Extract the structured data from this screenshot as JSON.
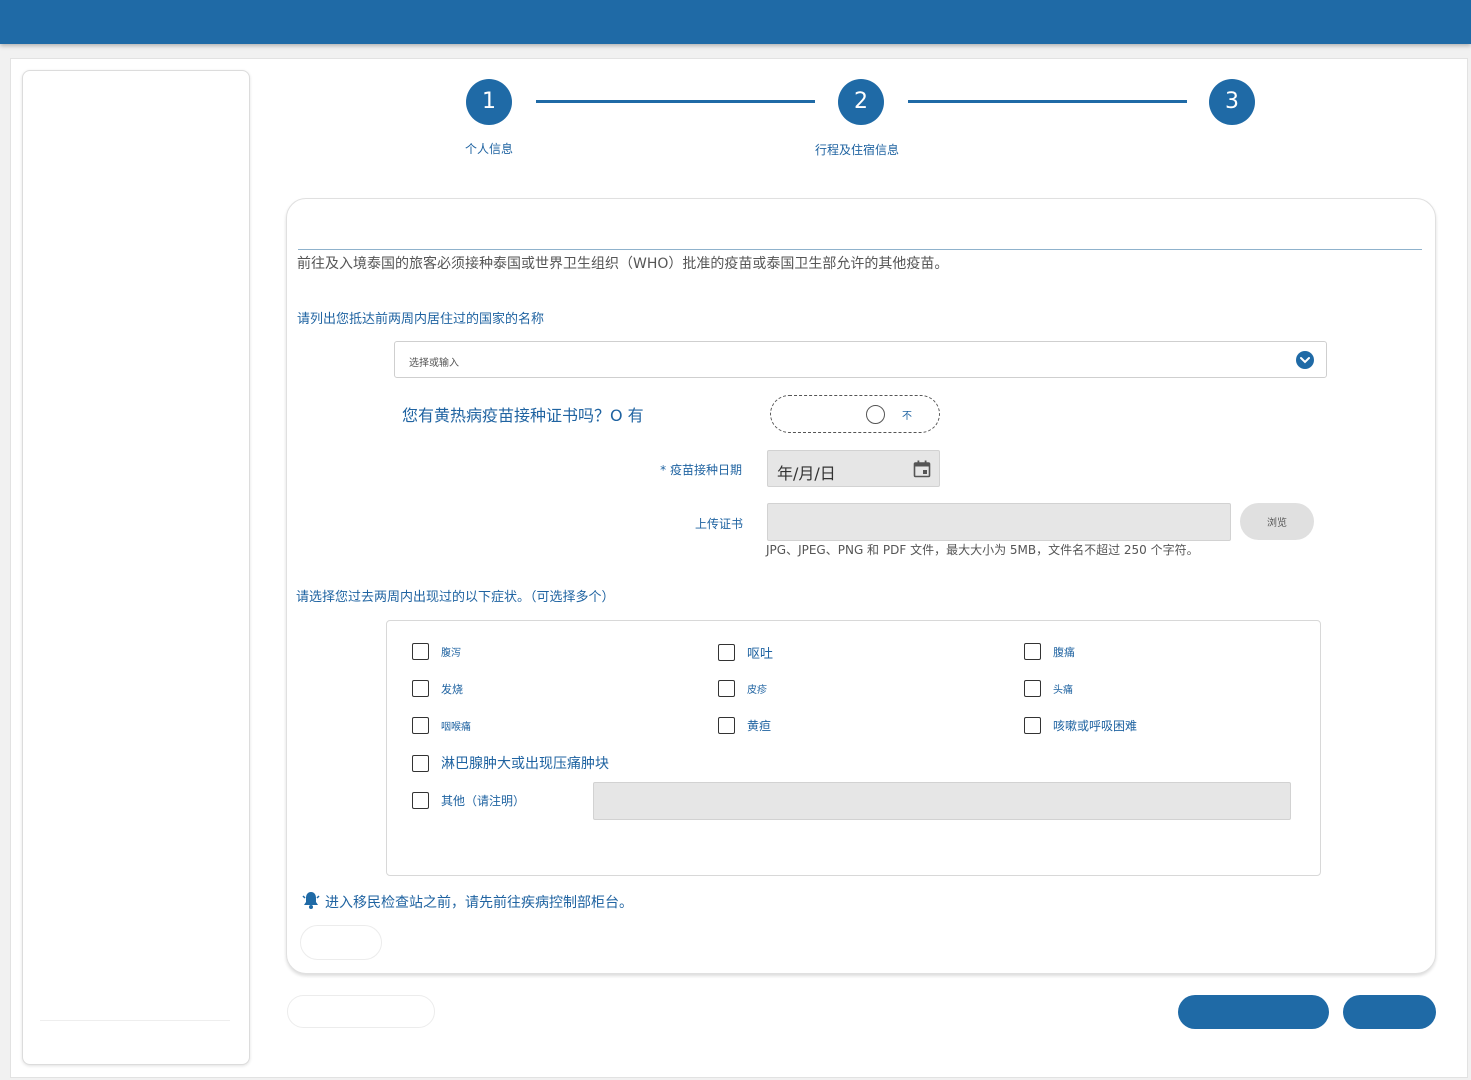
{
  "stepper": {
    "steps": [
      {
        "number": "1",
        "label": "个人信息"
      },
      {
        "number": "2",
        "label": "行程及住宿信息"
      },
      {
        "number": "3",
        "label": ""
      }
    ]
  },
  "form": {
    "notice": "前往及入境泰国的旅客必须接种泰国或世界卫生组织（WHO）批准的疫苗或泰国卫生部允许的其他疫苗。",
    "countries_question": "请列出您抵达前两周内居住过的国家的名称",
    "countries_placeholder": "选择或输入",
    "yellow_fever_question": "您有黄热病疫苗接种证书吗？O 有",
    "yellow_fever_no": "不",
    "vaccine_date_label": "* 疫苗接种日期",
    "vaccine_date_placeholder": "年/月/日",
    "upload_label": "上传证书",
    "browse_label": "浏览",
    "upload_hint": "JPG、JPEG、PNG 和 PDF 文件，最大大小为 5MB，文件名不超过 250 个字符。",
    "symptoms_question": "请选择您过去两周内出现过的以下症状。（可选择多个）",
    "symptoms": [
      {
        "label": "腹泻"
      },
      {
        "label": "呕吐"
      },
      {
        "label": "腹痛"
      },
      {
        "label": "发烧"
      },
      {
        "label": "皮疹"
      },
      {
        "label": "头痛"
      },
      {
        "label": "咽喉痛"
      },
      {
        "label": "黄疸"
      },
      {
        "label": "咳嗽或呼吸困难"
      },
      {
        "label": "淋巴腺肿大或出现压痛肿块"
      },
      {
        "label": "其他（请注明）"
      }
    ],
    "alert": "进入移民检查站之前，请先前往疾病控制部柜台。"
  },
  "colors": {
    "primary": "#1f6aa6",
    "text_blue": "#1f63a1",
    "input_gray": "#e6e6e6"
  }
}
